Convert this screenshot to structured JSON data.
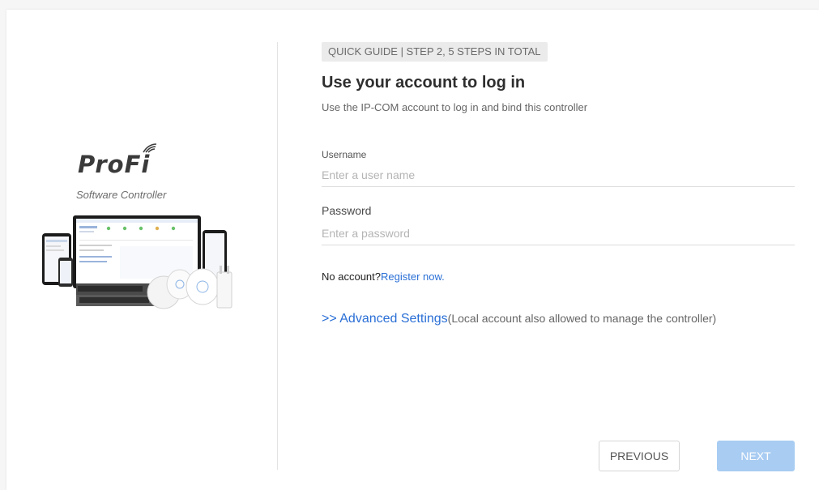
{
  "brand": {
    "logo_text": "ProFi",
    "subtitle": "Software Controller"
  },
  "guide": {
    "step_tag": "QUICK GUIDE | STEP 2, 5 STEPS IN TOTAL",
    "title": "Use your account to log in",
    "description": "Use the IP-COM account to log in and bind this controller"
  },
  "form": {
    "username": {
      "label": "Username",
      "placeholder": "Enter a user name",
      "value": ""
    },
    "password": {
      "label": "Password",
      "placeholder": "Enter a password",
      "value": ""
    }
  },
  "register": {
    "prompt": "No account?",
    "link_label": "Register now."
  },
  "advanced": {
    "link_label": ">> Advanced Settings",
    "note": "(Local account also allowed to manage the controller)"
  },
  "buttons": {
    "previous_label": "PREVIOUS",
    "next_label": "NEXT"
  },
  "colors": {
    "accent": "#2a6fd6",
    "next_button_disabled": "#a8ccf2",
    "step_tag_bg": "#ebebeb"
  },
  "icons": {
    "brand_logo": "profi-wifi-logo",
    "product_image": "devices-illustration"
  }
}
